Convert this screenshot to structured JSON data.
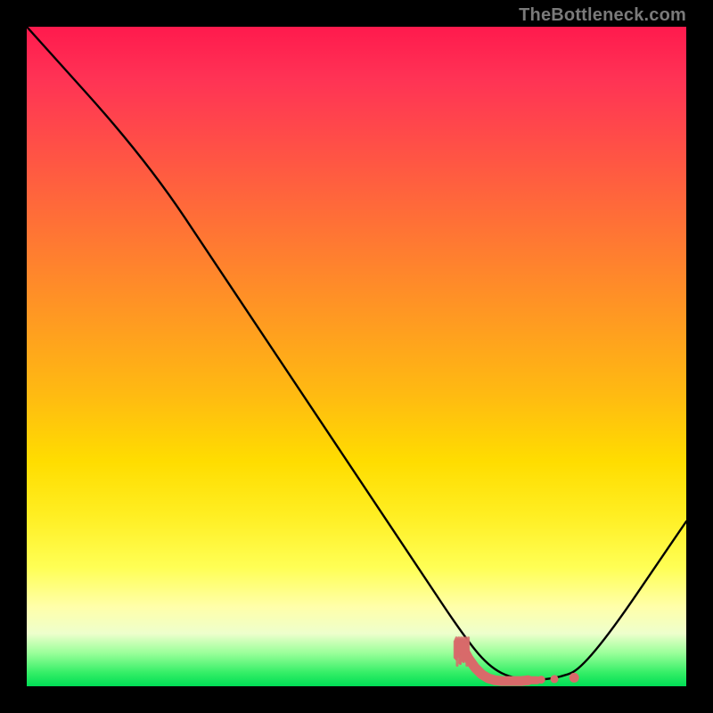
{
  "watermark": "TheBottleneck.com",
  "colors": {
    "background": "#000000",
    "curve": "#000000",
    "marker": "#d86a6a",
    "gradient_top": "#ff1a4d",
    "gradient_bottom": "#00dd55"
  },
  "chart_data": {
    "type": "line",
    "title": "",
    "xlabel": "",
    "ylabel": "",
    "xlim": [
      0,
      100
    ],
    "ylim": [
      0,
      100
    ],
    "grid": false,
    "legend": false,
    "series": [
      {
        "name": "bottleneck-curve",
        "x": [
          0,
          18,
          30,
          40,
          50,
          60,
          66,
          70,
          74,
          80,
          85,
          100
        ],
        "y": [
          100,
          80,
          62,
          47,
          32,
          17,
          8,
          3,
          1,
          1,
          3,
          25
        ]
      }
    ],
    "markers": [
      {
        "name": "optimal-zone",
        "style": "dotted-thick",
        "color": "#d86a6a",
        "x": [
          66,
          67,
          68,
          69,
          70,
          71,
          72,
          73,
          74,
          75,
          76,
          78,
          80,
          83
        ],
        "y": [
          6.0,
          4.2,
          2.8,
          1.8,
          1.2,
          0.9,
          0.8,
          0.8,
          0.8,
          0.8,
          0.9,
          1.0,
          1.1,
          1.3
        ]
      }
    ]
  }
}
